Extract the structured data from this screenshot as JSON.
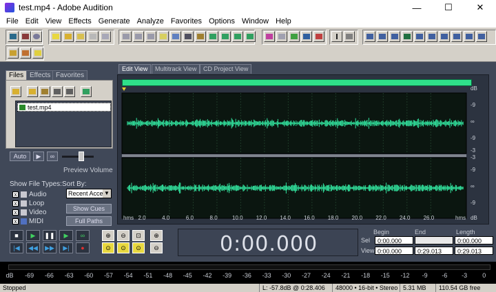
{
  "window": {
    "title": "test.mp4 - Adobe Audition",
    "minimize": "—",
    "maximize": "☐",
    "close": "✕"
  },
  "menu": [
    "File",
    "Edit",
    "View",
    "Effects",
    "Generate",
    "Analyze",
    "Favorites",
    "Options",
    "Window",
    "Help"
  ],
  "left_panel": {
    "tabs": [
      "Files",
      "Effects",
      "Favorites"
    ],
    "file_name": "test.mp4",
    "auto_label": "Auto",
    "preview_volume_label": "Preview Volume",
    "show_file_types_label": "Show File Types:",
    "file_types": [
      "Audio",
      "Loop",
      "Video",
      "MIDI"
    ],
    "sort_by_label": "Sort By:",
    "sort_value": "Recent Acce",
    "show_cues_label": "Show Cues",
    "full_paths_label": "Full Paths"
  },
  "view_tabs": [
    "Edit View",
    "Multitrack View",
    "CD Project View"
  ],
  "waveform": {
    "amplitude_labels": [
      "dB",
      "-9",
      "∞",
      "-9",
      "-3",
      "-3",
      "-9",
      "∞",
      "-9",
      "dB"
    ],
    "time_unit": "hms",
    "time_ticks": [
      "2.0",
      "4.0",
      "6.0",
      "8.0",
      "10.0",
      "12.0",
      "14.0",
      "16.0",
      "18.0",
      "20.0",
      "22.0",
      "24.0",
      "26.0"
    ],
    "wave_color": "#33e6a0",
    "background_color": "#0b1610"
  },
  "time_display": "0:00.000",
  "selection": {
    "headers": [
      "Begin",
      "End",
      "Length"
    ],
    "sel_label": "Sel",
    "view_label": "View",
    "sel_begin": "0:00.000",
    "sel_end": "",
    "sel_length": "0:00.000",
    "view_begin": "0:00.000",
    "view_end": "0:29.013",
    "view_length": "0:29.013"
  },
  "meter_ticks": [
    "dB",
    "-69",
    "-66",
    "-63",
    "-60",
    "-57",
    "-54",
    "-51",
    "-48",
    "-45",
    "-42",
    "-39",
    "-36",
    "-33",
    "-30",
    "-27",
    "-24",
    "-21",
    "-18",
    "-15",
    "-12",
    "-9",
    "-6",
    "-3",
    "0"
  ],
  "status": {
    "state": "Stopped",
    "cursor_level": "L: -57.8dB @",
    "cursor_time": "0:28.406",
    "format": "48000 • 16-bit • Stereo",
    "size": "5.31 MB",
    "free": "110.54 GB free"
  }
}
